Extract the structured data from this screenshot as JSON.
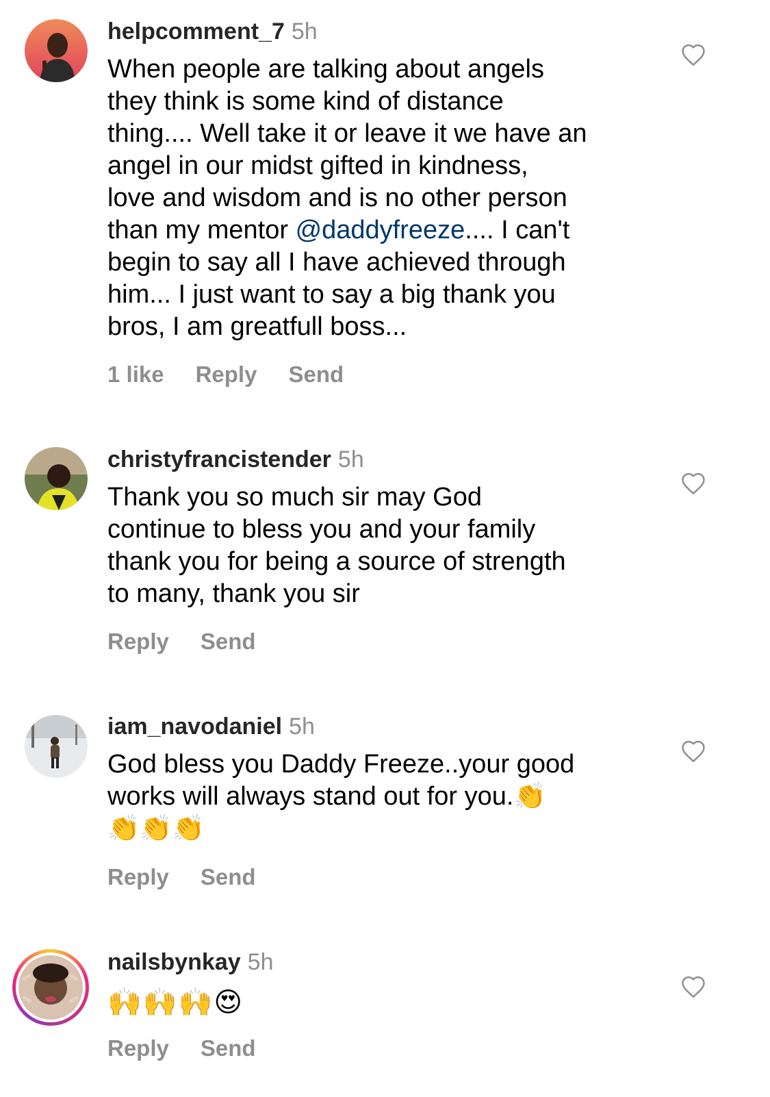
{
  "comments": [
    {
      "username": "helpcomment_7",
      "time": "5h",
      "text_before": "When people are talking about angels\nthey think is some kind of distance\nthing.... Well take it or leave it we have an\nangel in our midst gifted in kindness,\nlove and wisdom and is no other person\nthan my mentor ",
      "mention": "@daddyfreeze",
      "text_after": ".... I can't\nbegin to say all I have achieved through\nhim... I just want to say a big thank you\nbros, I am greatfull boss...",
      "likes": "1 like",
      "reply": "Reply",
      "send": "Send"
    },
    {
      "username": "christyfrancistender",
      "time": "5h",
      "text": "Thank you so much sir may God\ncontinue to bless you and your family\nthank you for being a source of strength\nto many, thank you sir",
      "reply": "Reply",
      "send": "Send"
    },
    {
      "username": "iam_navodaniel",
      "time": "5h",
      "text": "God bless you Daddy Freeze..your good\nworks will always stand out for you.👏\n👏👏👏",
      "reply": "Reply",
      "send": "Send"
    },
    {
      "username": "nailsbynkay",
      "time": "5h",
      "text": "🙌🙌🙌😍",
      "reply": "Reply",
      "send": "Send"
    }
  ],
  "icons": {
    "like": "heart-outline-icon"
  },
  "colors": {
    "mention": "#00376b",
    "meta": "#8e8e8e"
  }
}
